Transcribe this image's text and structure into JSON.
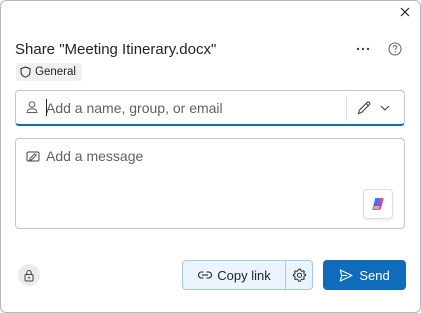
{
  "dialog": {
    "title": "Share \"Meeting Itinerary.docx\"",
    "sensitivity_label": "General"
  },
  "header_icons": {
    "close": "close-icon",
    "more": "more-options-icon",
    "help": "help-icon"
  },
  "people_picker": {
    "placeholder": "Add a name, group, or email",
    "value": "",
    "person_icon": "person-icon",
    "permission_icon": "edit-pencil-icon",
    "dropdown_icon": "chevron-down-icon"
  },
  "message": {
    "placeholder": "Add a message",
    "value": "",
    "icon": "message-icon",
    "copilot_icon": "copilot-icon"
  },
  "footer": {
    "copy_link_label": "Copy link",
    "send_label": "Send",
    "lock_icon": "lock-icon",
    "link_icon": "link-icon",
    "settings_icon": "gear-icon",
    "send_icon": "send-icon"
  },
  "colors": {
    "accent": "#0f6cbd",
    "copy_link_bg": "#ebf3fc",
    "copy_link_border": "#a6c8ea"
  }
}
